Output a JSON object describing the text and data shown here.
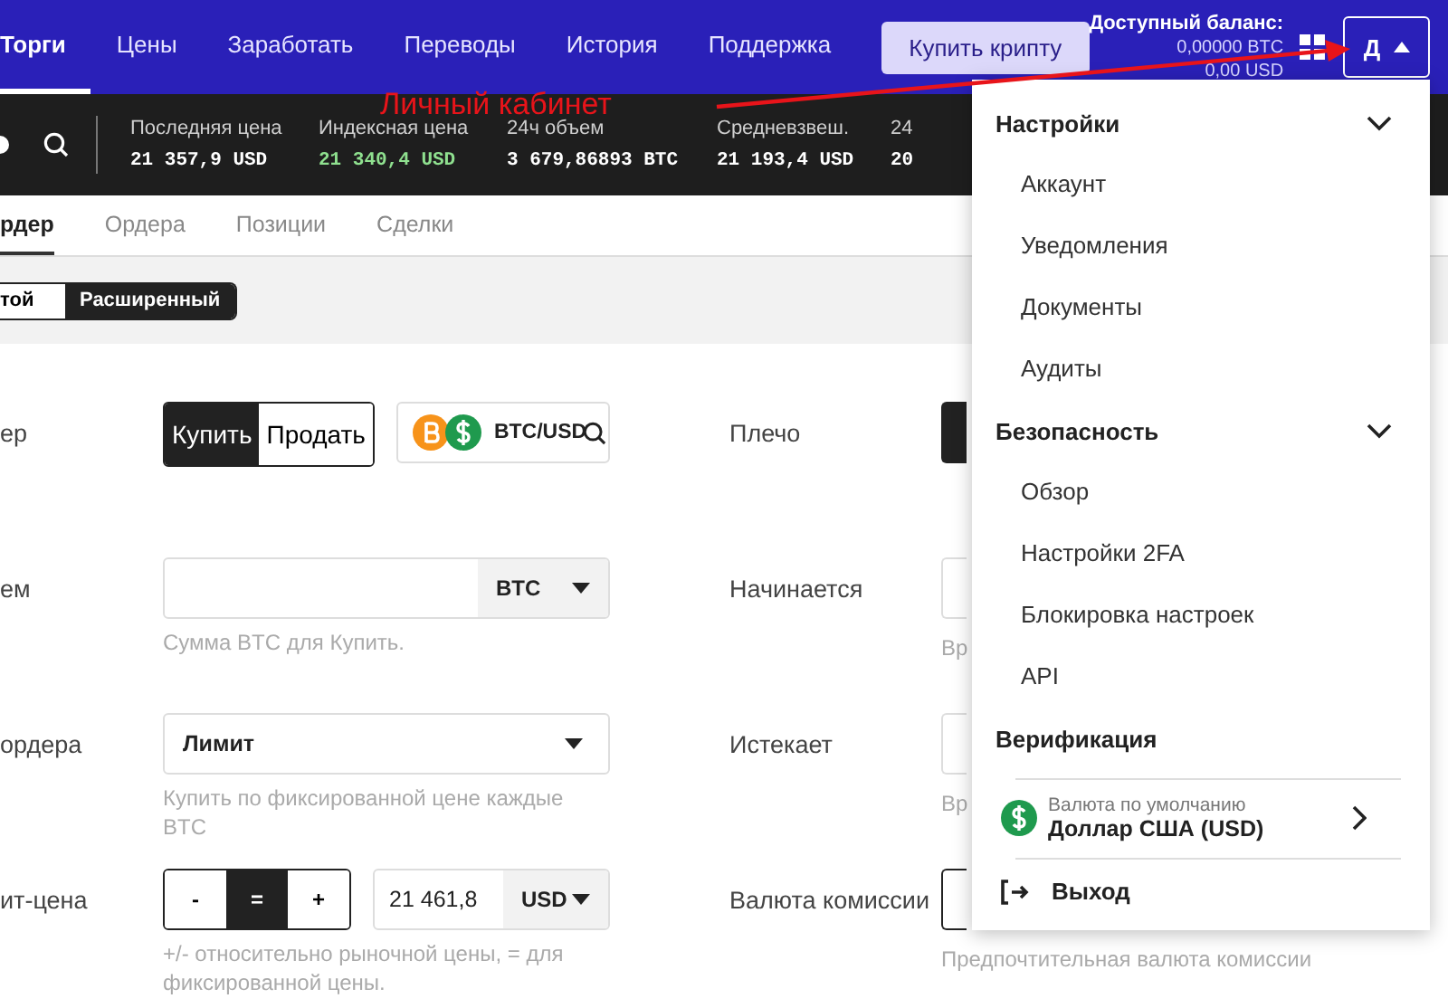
{
  "header": {
    "nav": [
      {
        "label": "Торги",
        "selected": true
      },
      {
        "label": "Цены",
        "selected": false
      },
      {
        "label": "Заработать",
        "selected": false
      },
      {
        "label": "Переводы",
        "selected": false
      },
      {
        "label": "История",
        "selected": false
      },
      {
        "label": "Поддержка",
        "selected": false
      }
    ],
    "buy_button": "Купить крипту",
    "balance": {
      "label": "Доступный баланс:",
      "btc": "0,00000 BTC",
      "usd": "0,00 USD"
    },
    "account_button": {
      "label": "Д",
      "expanded": true
    }
  },
  "annotation": {
    "label": "Личный кабинет"
  },
  "ticker": [
    {
      "label": "Последняя цена",
      "value": "21 357,9 USD",
      "kind": "plain"
    },
    {
      "label": "Индексная цена",
      "value": "21 340,4 USD",
      "kind": "up"
    },
    {
      "label": "24ч объем",
      "value": "3 679,86893 BTC",
      "kind": "plain"
    },
    {
      "label": "Средневзвеш.",
      "value": "21 193,4 USD",
      "kind": "plain"
    },
    {
      "label": "24",
      "value": "20",
      "kind": "plain"
    }
  ],
  "tabs": [
    {
      "label": "рдер",
      "selected": true
    },
    {
      "label": "Ордера",
      "selected": false
    },
    {
      "label": "Позиции",
      "selected": false
    },
    {
      "label": "Сделки",
      "selected": false
    }
  ],
  "mode_toggle": [
    {
      "label": "той",
      "selected": false
    },
    {
      "label": "Расширенный",
      "selected": true
    }
  ],
  "form": {
    "left": [
      {
        "label": "ер",
        "kind": "side",
        "options": [
          {
            "label": "Купить",
            "selected": true
          },
          {
            "label": "Продать",
            "selected": false
          }
        ],
        "pair": "BTC/USD"
      },
      {
        "label": "ем",
        "kind": "amount",
        "unit": "BTC",
        "hint": "Сумма BTC для Купить."
      },
      {
        "label": "ордера",
        "kind": "select",
        "value": "Лимит",
        "hint": "Купить по фиксированной цене каждые BTC"
      },
      {
        "label": "ит-цена",
        "kind": "price",
        "modes": [
          {
            "label": "-",
            "selected": false
          },
          {
            "label": "=",
            "selected": true
          },
          {
            "label": "+",
            "selected": false
          }
        ],
        "value": "21 461,8",
        "unit": "USD",
        "hint": "+/- относительно рыночной цены, = для фиксированной цены."
      }
    ],
    "right": [
      {
        "label": "Плечо",
        "kind": "dark"
      },
      {
        "label": "Начинается",
        "kind": "field",
        "hint": "Вр"
      },
      {
        "label": "Истекает",
        "kind": "field",
        "hint": "Вр"
      },
      {
        "label": "Валюта комиссии",
        "kind": "outlined",
        "hint": "Предпочтительная валюта комиссии"
      }
    ]
  },
  "menu": {
    "sections": [
      {
        "title": "Настройки",
        "expanded": true,
        "items": [
          "Аккаунт",
          "Уведомления",
          "Документы",
          "Аудиты"
        ]
      },
      {
        "title": "Безопасность",
        "expanded": true,
        "items": [
          "Обзор",
          "Настройки 2FA",
          "Блокировка настроек",
          "API"
        ]
      },
      {
        "title": "Верификация"
      }
    ],
    "currency": {
      "label": "Валюта по умолчанию",
      "value": "Доллар США (USD)"
    },
    "logout": "Выход"
  }
}
